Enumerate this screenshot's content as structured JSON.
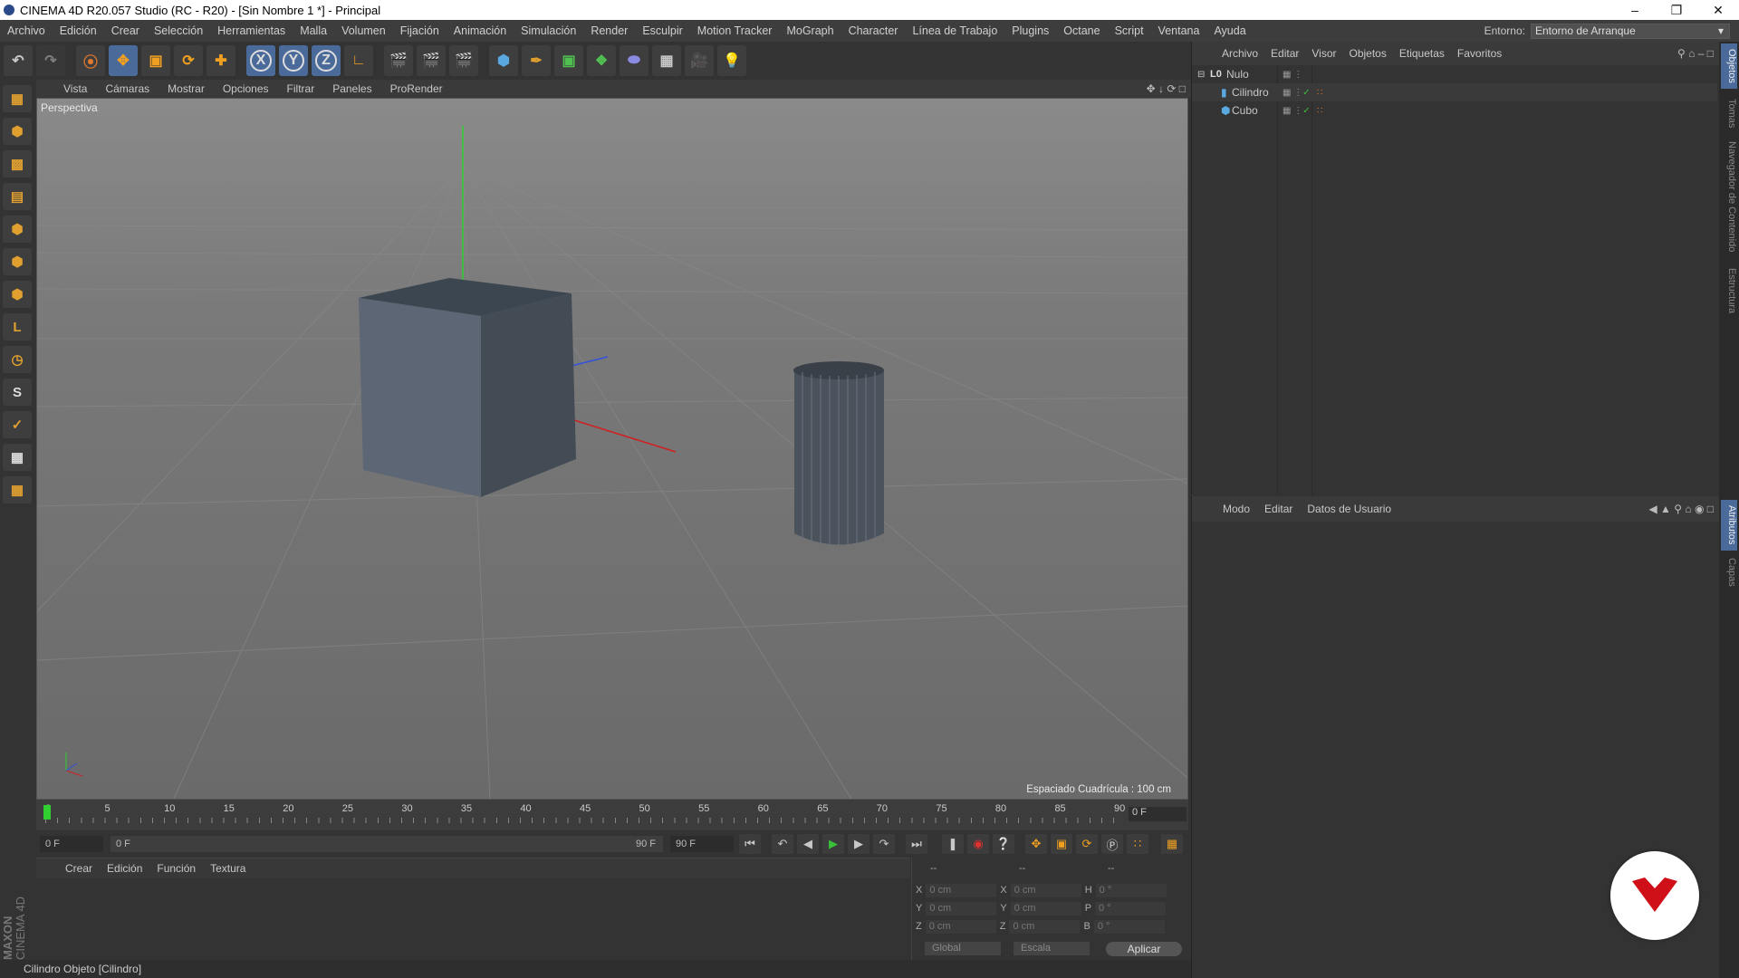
{
  "window": {
    "title": "CINEMA 4D R20.057 Studio (RC - R20) - [Sin Nombre 1 *] - Principal"
  },
  "menubar": {
    "items": [
      "Archivo",
      "Edición",
      "Crear",
      "Selección",
      "Herramientas",
      "Malla",
      "Volumen",
      "Fijación",
      "Animación",
      "Simulación",
      "Render",
      "Esculpir",
      "Motion Tracker",
      "MoGraph",
      "Character",
      "Línea de Trabajo",
      "Plugins",
      "Octane",
      "Script",
      "Ventana",
      "Ayuda"
    ],
    "env_label": "Entorno:",
    "env_value": "Entorno de Arranque"
  },
  "toolbar": {
    "axis_x": "X",
    "axis_y": "Y",
    "axis_z": "Z"
  },
  "viewport": {
    "menu": [
      "Vista",
      "Cámaras",
      "Mostrar",
      "Opciones",
      "Filtrar",
      "Paneles",
      "ProRender"
    ],
    "label": "Perspectiva",
    "grid_info": "Espaciado Cuadrícula : 100 cm"
  },
  "timeline": {
    "ticks": [
      "0",
      "5",
      "10",
      "15",
      "20",
      "25",
      "30",
      "35",
      "40",
      "45",
      "50",
      "55",
      "60",
      "65",
      "70",
      "75",
      "80",
      "85",
      "90"
    ],
    "current_frame": "0 F",
    "start": "0 F",
    "range_start": "0 F",
    "range_end": "90 F",
    "end": "90 F"
  },
  "materials": {
    "menu": [
      "Crear",
      "Edición",
      "Función",
      "Textura"
    ]
  },
  "coords": {
    "headers": [
      "--",
      "--",
      "--"
    ],
    "rows": [
      {
        "a": "X",
        "av": "0 cm",
        "b": "X",
        "bv": "0 cm",
        "c": "H",
        "cv": "0 °"
      },
      {
        "a": "Y",
        "av": "0 cm",
        "b": "Y",
        "bv": "0 cm",
        "c": "P",
        "cv": "0 °"
      },
      {
        "a": "Z",
        "av": "0 cm",
        "b": "Z",
        "bv": "0 cm",
        "c": "B",
        "cv": "0 °"
      }
    ],
    "global": "Global",
    "scale": "Escala",
    "apply": "Aplicar"
  },
  "objects": {
    "menu": [
      "Archivo",
      "Editar",
      "Visor",
      "Objetos",
      "Etiquetas",
      "Favoritos"
    ],
    "items": [
      {
        "name": "Nulo",
        "level": 0
      },
      {
        "name": "Cilindro",
        "level": 1
      },
      {
        "name": "Cubo",
        "level": 1
      }
    ]
  },
  "attributes": {
    "menu": [
      "Modo",
      "Editar",
      "Datos de Usuario"
    ]
  },
  "right_tabs": [
    "Objetos",
    "Tomas",
    "Navegador de Contenido",
    "Estructura",
    "Atributos",
    "Capas"
  ],
  "logo": {
    "line1": "MAXON",
    "line2": "CINEMA 4D"
  },
  "status": "Cilindro Objeto [Cilindro]",
  "colors": {
    "accent": "#4a6a9a",
    "viewport_bg": "#7a7a7a",
    "badge": "#d01018"
  }
}
